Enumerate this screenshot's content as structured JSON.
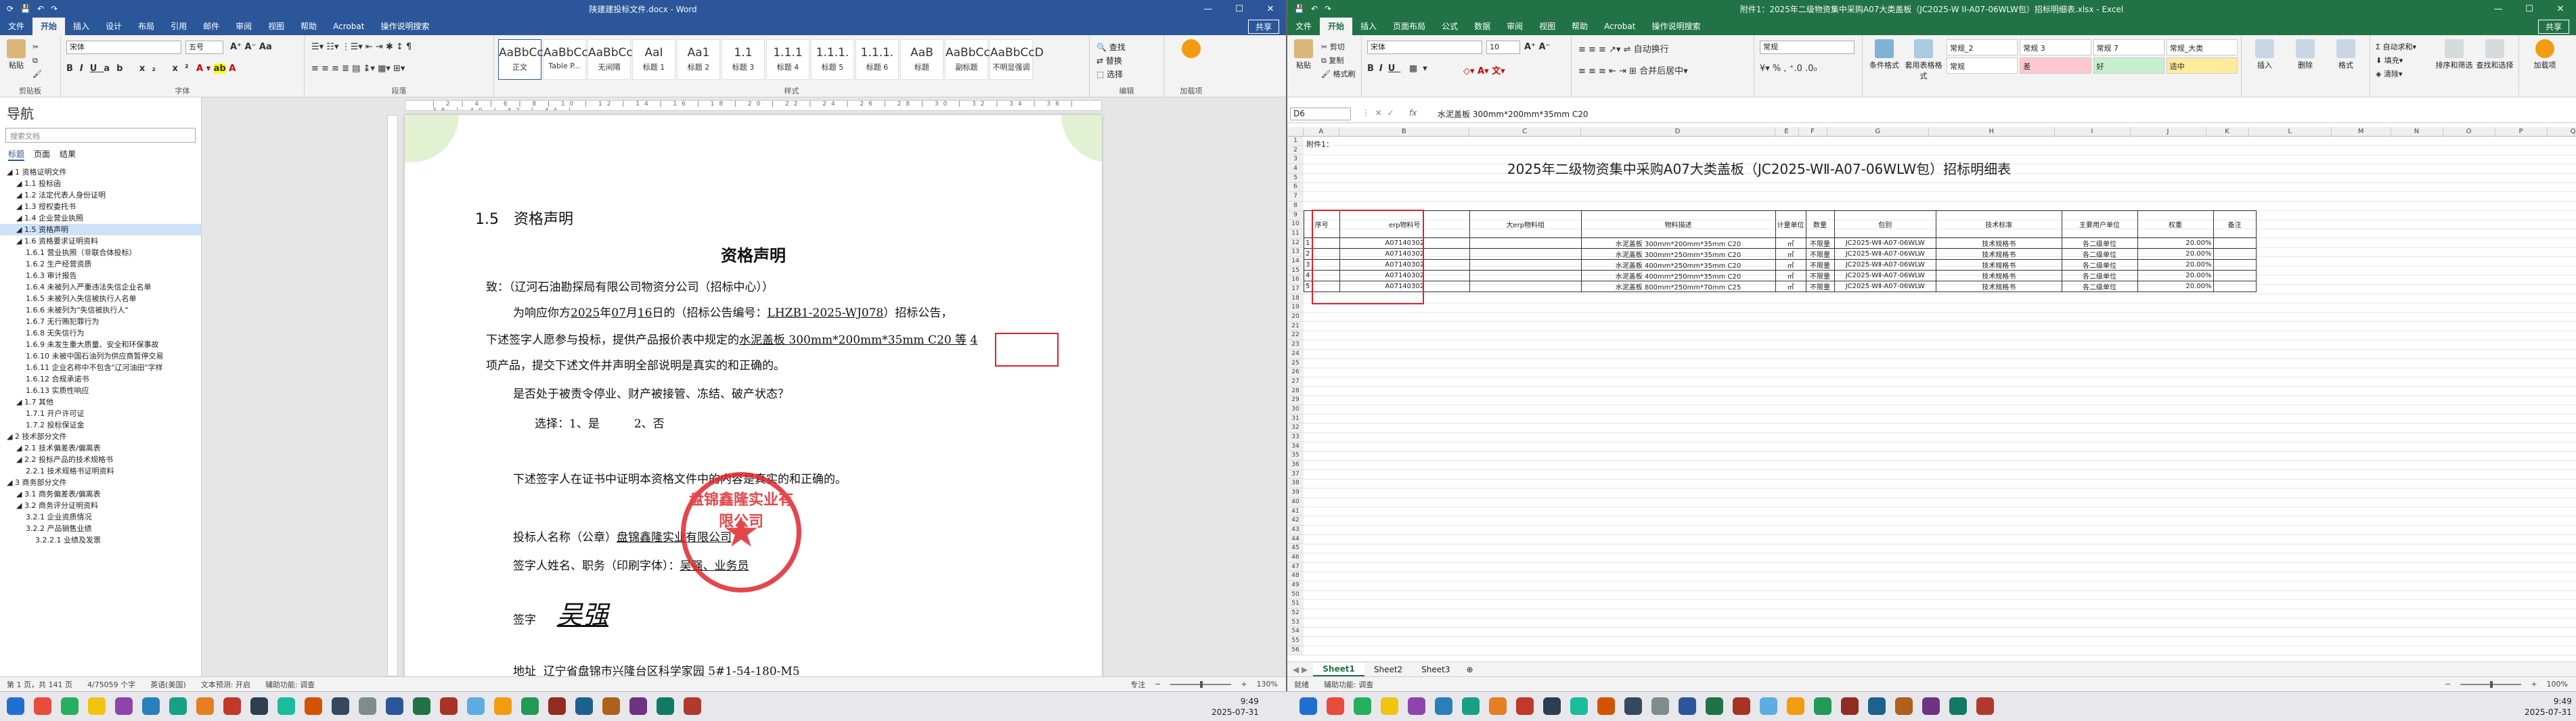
{
  "word": {
    "title": "陕建建投标文件.docx - Word",
    "share": "共享",
    "tabs": [
      "文件",
      "开始",
      "插入",
      "设计",
      "布局",
      "引用",
      "邮件",
      "审阅",
      "视图",
      "帮助",
      "Acrobat",
      "操作说明搜索"
    ],
    "active_tab": "开始",
    "font_name": "宋体",
    "font_size": "五号",
    "clipboard_label": "剪贴板",
    "font_label": "字体",
    "paragraph_label": "段落",
    "styles_label": "样式",
    "styles": [
      {
        "preview": "AaBbCcDd",
        "name": "正文"
      },
      {
        "preview": "AaBbCcDd",
        "name": "Table P..."
      },
      {
        "preview": "AaBbCcDd",
        "name": "无间隔"
      },
      {
        "preview": "AaI",
        "name": "标题 1"
      },
      {
        "preview": "Aa1",
        "name": "标题 2"
      },
      {
        "preview": "1.1",
        "name": "标题 3"
      },
      {
        "preview": "1.1.1",
        "name": "标题 4"
      },
      {
        "preview": "1.1.1.",
        "name": "标题 5"
      },
      {
        "preview": "1.1.1.",
        "name": "标题 6"
      },
      {
        "preview": "AaB",
        "name": "标题"
      },
      {
        "preview": "AaBbCcD",
        "name": "副标题"
      },
      {
        "preview": "AaBbCcD",
        "name": "不明显强调"
      }
    ],
    "edit_items": [
      "查找",
      "替换",
      "选择"
    ],
    "edit_label": "编辑",
    "addin_label": "加载项",
    "nav": {
      "header": "导航",
      "search_placeholder": "搜索文档",
      "tabs": [
        "标题",
        "页面",
        "结果"
      ],
      "items": [
        "1 资格证明文件",
        "1.1 投标函",
        "1.2 法定代表人身份证明",
        "1.3 授权委托书",
        "1.4 企业营业执照",
        "1.5 资格声明",
        "1.6 资格要求证明资料",
        "1.6.1 营业执照（非联合体投标）",
        "1.6.2 生产经营资质",
        "1.6.3 审计报告",
        "1.6.4 未被列入严重违法失信企业名单",
        "1.6.5 未被列入失信被执行人名单",
        "1.6.6 未被列为\"失信被执行人\"",
        "1.6.7 无行贿犯罪行为",
        "1.6.8 无失信行为",
        "1.6.9 未发生重大质量、安全和环保事故",
        "1.6.10 未被中国石油列为供应商暂停交易",
        "1.6.11 企业名称中不包含\"辽河油田\"字样",
        "1.6.12 合规承诺书",
        "1.6.13 实质性响应",
        "1.7 其他",
        "1.7.1 开户许可证",
        "1.7.2 投标保证金",
        "2 技术部分文件",
        "2.1 技术偏差表/偏离表",
        "2.2 投标产品的技术规格书",
        "2.2.1 技术规格书证明资料",
        "3 商务部分文件",
        "3.1 商务偏差表/偏离表",
        "3.2 商务评分证明资料",
        "3.2.1 企业资质情况",
        "3.2.2 产品销售业绩",
        "3.2.2.1 业绩及发票"
      ],
      "selected_index": 5
    },
    "doc": {
      "heading": "1.5　资格声明",
      "title": "资格声明",
      "to_line": "致：（辽河石油勘探局有限公司物资分公司（招标中心））",
      "p1_a": "为响应你方",
      "p1_year": "2025",
      "p1_b": "年",
      "p1_month": "07",
      "p1_c": "月",
      "p1_day": "16",
      "p1_d": "日的（招标公告编号：",
      "p1_no": "LHZB1-2025-WJ078",
      "p1_e": "）招标公告，",
      "p2_a": "下述签字人愿参与投标，提供产品报价表中规定的",
      "p2_prod": "水泥盖板 300mm*200mm*35mm C20 等",
      "p2_count": "4",
      "p3": "项产品，提交下述文件并声明全部说明是真实的和正确的。",
      "q1": "是否处于被责令停业、财产被接管、冻结、破产状态？",
      "choice": "选择：1、是　　　2、否",
      "p4": "下述签字人在证书中证明本资格文件中的内容是真实的和正确的。",
      "bidder_label": "投标人名称（公章）",
      "bidder": "盘锦鑫隆实业有限公司",
      "signer_label": "签字人姓名、职务（印刷字体）：",
      "signer": "吴强、业务员",
      "sign_label": "签字",
      "signature": "吴强",
      "addr_label": "地址",
      "addr": "辽宁省盘锦市兴隆台区科学家园 5#1-54-180-M5",
      "stamp_text": "盘锦鑫隆实业有限公司"
    },
    "status": {
      "page": "第 1 页，共 141 页",
      "words": "4/75059 个字",
      "lang": "英语(美国)",
      "predict": "文本预测: 开启",
      "access": "辅助功能: 调查",
      "focus": "专注",
      "zoom": "130%"
    }
  },
  "excel": {
    "title": "附件1：2025年二级物资集中采购A07大类盖板（JC2025-W II-A07-06WLW包）招标明细表.xlsx - Excel",
    "share": "共享",
    "tabs": [
      "文件",
      "开始",
      "插入",
      "页面布局",
      "公式",
      "数据",
      "审阅",
      "视图",
      "帮助",
      "Acrobat",
      "操作说明搜索"
    ],
    "active_tab": "开始",
    "font_name": "宋体",
    "font_size": "10",
    "number_format": "常规",
    "styles": [
      {
        "name": "常规_2",
        "bg": "#ffffff"
      },
      {
        "name": "常规 3",
        "bg": "#ffffff"
      },
      {
        "name": "常规 7",
        "bg": "#ffffff"
      },
      {
        "name": "常规_大类",
        "bg": "#ffffff"
      },
      {
        "name": "常规",
        "bg": "#ffffff"
      },
      {
        "name": "差",
        "bg": "#ffc7ce"
      },
      {
        "name": "好",
        "bg": "#c6efce"
      },
      {
        "name": "适中",
        "bg": "#ffeb9c"
      }
    ],
    "cond_format": "条件格式",
    "table_format": "套用表格格式",
    "insert": "插入",
    "delete": "删除",
    "format": "格式",
    "sort": "排序和筛选",
    "find": "查找和选择",
    "addins": "加载项",
    "namebox": "D6",
    "formula": "水泥盖板 300mm*200mm*35mm C20",
    "columns": [
      "A",
      "B",
      "C",
      "D",
      "E",
      "F",
      "G",
      "H",
      "I",
      "J",
      "K",
      "L",
      "M",
      "N",
      "O",
      "P",
      "Q",
      "R",
      "S"
    ],
    "attach": "附件1：",
    "sheet_title": "2025年二级物资集中采购A07大类盖板（JC2025-WⅡ-A07-06WLW包）招标明细表",
    "headers": [
      "序号",
      "erp物料号",
      "大erp物料组",
      "物料描述",
      "计量单位",
      "数量",
      "包别",
      "技术标准",
      "主要用户单位",
      "权重",
      "备注"
    ],
    "rows": [
      [
        "1",
        "A07140302",
        "",
        "水泥盖板 300mm*200mm*35mm C20",
        "㎡",
        "不限量",
        "JC2025-WⅡ-A07-06WLW",
        "技术规格书",
        "各二级单位",
        "20.00%",
        ""
      ],
      [
        "2",
        "A07140302",
        "",
        "水泥盖板 300mm*250mm*35mm C20",
        "㎡",
        "不限量",
        "JC2025-WⅡ-A07-06WLW",
        "技术规格书",
        "各二级单位",
        "20.00%",
        ""
      ],
      [
        "3",
        "A07140302",
        "",
        "水泥盖板 400mm*250mm*35mm C20",
        "㎡",
        "不限量",
        "JC2025-WⅡ-A07-06WLW",
        "技术规格书",
        "各二级单位",
        "20.00%",
        ""
      ],
      [
        "4",
        "A07140302",
        "",
        "水泥盖板 400mm*250mm*35mm C20",
        "㎡",
        "不限量",
        "JC2025-WⅡ-A07-06WLW",
        "技术规格书",
        "各二级单位",
        "20.00%",
        ""
      ],
      [
        "5",
        "A07140302",
        "",
        "水泥盖板 800mm*250mm*70mm C25",
        "㎡",
        "不限量",
        "JC2025-WⅡ-A07-06WLW",
        "技术规格书",
        "各二级单位",
        "20.00%",
        ""
      ]
    ],
    "sheets": [
      "Sheet1",
      "Sheet2",
      "Sheet3"
    ],
    "status": {
      "ready": "就绪",
      "access": "辅助功能: 调查",
      "zoom": "100%"
    }
  },
  "taskbar": {
    "time": "9:49",
    "date": "2025-07-31"
  }
}
